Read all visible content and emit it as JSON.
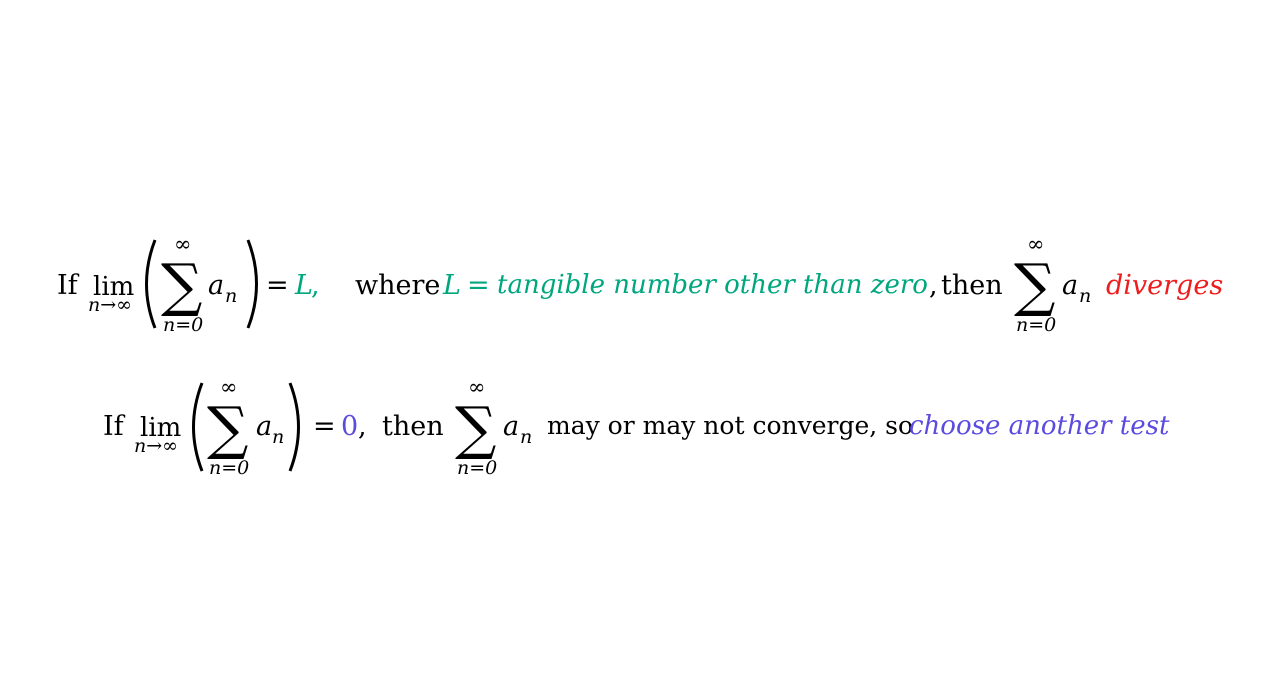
{
  "colors": {
    "text": "#000000",
    "green": "#00a77e",
    "red": "#ee1c1c",
    "purple": "#5b4bdf"
  },
  "statements": [
    {
      "if": "If",
      "lim": "lim",
      "lim_sub": "n→∞",
      "sum_upper": "∞",
      "sigma": "∑",
      "sum_lower": "n=0",
      "term": "a",
      "term_sub": "n",
      "equals": "=",
      "value": "L",
      "comma": ",",
      "where": "where",
      "def_var": "L",
      "def_eq": "=",
      "def_text": "tangible number other than zero",
      "def_comma": ",",
      "then": "then",
      "result_sum_upper": "∞",
      "result_sigma": "∑",
      "result_sum_lower": "n=0",
      "result_term": "a",
      "result_term_sub": "n",
      "conclusion": "diverges"
    },
    {
      "if": "If",
      "lim": "lim",
      "lim_sub": "n→∞",
      "sum_upper": "∞",
      "sigma": "∑",
      "sum_lower": "n=0",
      "term": "a",
      "term_sub": "n",
      "equals": "=",
      "value": "0",
      "comma": ",",
      "then": "then",
      "result_sum_upper": "∞",
      "result_sigma": "∑",
      "result_sum_lower": "n=0",
      "result_term": "a",
      "result_term_sub": "n",
      "conclusion_plain": "may or may not converge, so",
      "conclusion": "choose another test"
    }
  ]
}
